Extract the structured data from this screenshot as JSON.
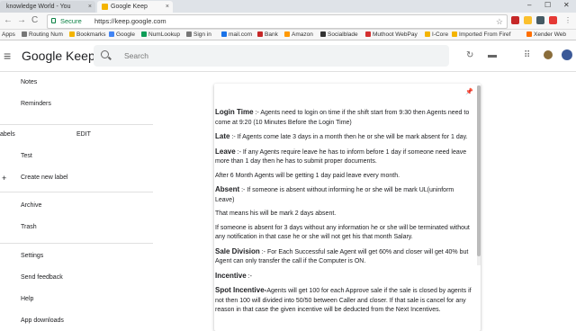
{
  "browser": {
    "tabs": [
      {
        "title": "knowledge World - You",
        "close": "×"
      },
      {
        "title": "Google Keep",
        "close": "×"
      }
    ],
    "window_controls": {
      "minimize": "–",
      "maximize": "☐",
      "close": "✕"
    },
    "nav": {
      "back": "←",
      "forward": "→",
      "reload": "C"
    },
    "secure_label": "Secure",
    "url": "https://keep.google.com",
    "bookmarks": [
      {
        "label": "Apps",
        "color": "#4285f4"
      },
      {
        "label": "Routing Num",
        "color": "#777777"
      },
      {
        "label": "Bookmarks",
        "color": "#f4b400"
      },
      {
        "label": "Google",
        "color": "#4285f4"
      },
      {
        "label": "NumLookup",
        "color": "#0f9d58"
      },
      {
        "label": "Sign in",
        "color": "#777777"
      },
      {
        "label": "mail.com",
        "color": "#1a73e8"
      },
      {
        "label": "Bank",
        "color": "#c62828"
      },
      {
        "label": "Amazon",
        "color": "#ff9900"
      },
      {
        "label": "Socialblade",
        "color": "#333333"
      },
      {
        "label": "Muthoot WebPay",
        "color": "#d32f2f"
      },
      {
        "label": "I-Core",
        "color": "#f4b400"
      },
      {
        "label": "Imported From Firef",
        "color": "#f4b400"
      },
      {
        "label": "Xender Web",
        "color": "#ff6f00"
      }
    ]
  },
  "keep": {
    "title": "Google Keep",
    "search_placeholder": "Search",
    "sidebar": {
      "notes": "Notes",
      "reminders": "Reminders",
      "labels_heading": "abels",
      "edit": "EDIT",
      "labels": [
        "Test"
      ],
      "create_label": "Create new label",
      "archive": "Archive",
      "trash": "Trash",
      "settings": "Settings",
      "feedback": "Send feedback",
      "help": "Help",
      "app_downloads": "App downloads"
    },
    "note": {
      "pin": "📌",
      "paragraphs": [
        {
          "head": "Login Time",
          "sep": " :-  ",
          "text": "Agents need to login on time if the shift start from 9:30 then Agents need to come at 9:20 (10 Minutes Before the Login Time)"
        },
        {
          "head": "Late",
          "sep": " :- ",
          "text": "If Agents come late 3 days in a month then he or she will be mark absent for 1 day."
        },
        {
          "head": "Leave",
          "sep": " :- ",
          "text": "If any Agents require leave he has to inform before 1 day if someone need leave more than 1 day then he has to submit proper documents."
        },
        {
          "head": "",
          "sep": "",
          "text": "After 6 Month Agents will be getting 1 day paid leave every month."
        },
        {
          "head": "Absent",
          "sep": " :- ",
          "text": "If someone is absent without informing he or she will be mark UL(uninform Leave)"
        },
        {
          "head": "",
          "sep": "",
          "text": "That means his will be mark 2 days absent."
        },
        {
          "head": "",
          "sep": "",
          "text": "If someone is absent for 3 days without any information he or she will be terminated without any notification in that case he or she will not get his that month Salary."
        },
        {
          "head": "Sale Division",
          "sep": " :- ",
          "text": "For Each Successful sale Agent will get 60% and closer will get 40% but Agent can only transfer the call if the Computer is ON."
        },
        {
          "head": "Incentive",
          "sep": " :-",
          "text": ""
        },
        {
          "head": " Spot Incentive-",
          "sep": "",
          "text": "Agents will get 100 for each Approve sale if the sale is closed by agents if not then 100 will divided into 50/50 between Caller and closer. If that sale is cancel for any reason in that case the given incentive will be deducted from the Next Incentives."
        }
      ]
    }
  }
}
